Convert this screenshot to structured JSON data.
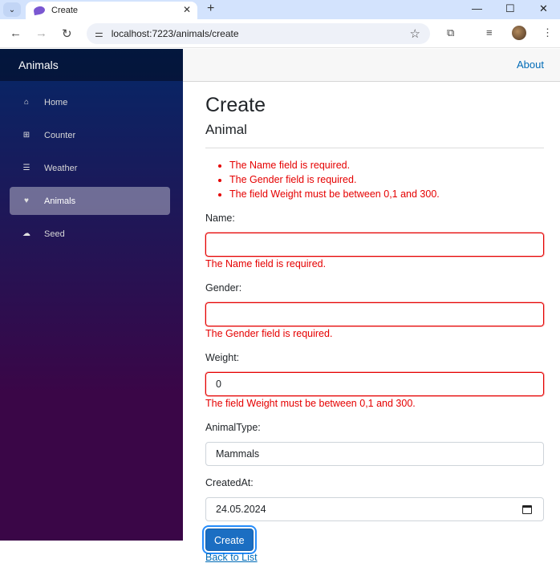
{
  "browser": {
    "tab_title": "Create",
    "url": "localhost:7223/animals/create",
    "icons": {
      "tab_list": "chevron-down-icon",
      "tab_close": "close-icon",
      "new_tab": "plus-icon",
      "minimize": "minimize-icon",
      "maximize": "maximize-icon",
      "close_window": "close-icon",
      "back": "arrow-left-icon",
      "forward": "arrow-right-icon",
      "reload": "reload-icon",
      "site_info": "tune-icon",
      "bookmark": "star-icon",
      "extensions": "puzzle-icon",
      "media": "media-queue-icon",
      "menu": "kebab-menu-icon"
    },
    "glyphs": {
      "tab_list": "⌄",
      "tab_close": "✕",
      "new_tab": "+",
      "minimize": "—",
      "maximize": "☐",
      "close_window": "✕",
      "back": "←",
      "forward": "→",
      "reload": "↻",
      "site_info": "⚌",
      "bookmark": "☆",
      "extensions": "⧉",
      "media": "≡",
      "menu": "⋮"
    }
  },
  "sidebar": {
    "brand": "Animals",
    "items": [
      {
        "label": "Home",
        "icon": "home-icon",
        "glyph": "⌂",
        "active": false
      },
      {
        "label": "Counter",
        "icon": "plus-square-icon",
        "glyph": "⊞",
        "active": false
      },
      {
        "label": "Weather",
        "icon": "list-icon",
        "glyph": "☰",
        "active": false
      },
      {
        "label": "Animals",
        "icon": "animal-icon",
        "glyph": "♥",
        "active": true
      },
      {
        "label": "Seed",
        "icon": "cloud-upload-icon",
        "glyph": "☁",
        "active": false
      }
    ]
  },
  "topbar": {
    "about_label": "About"
  },
  "page": {
    "title": "Create",
    "subtitle": "Animal",
    "validation_summary": [
      "The Name field is required.",
      "The Gender field is required.",
      "The field Weight must be between 0,1 and 300."
    ],
    "fields": {
      "name": {
        "label": "Name:",
        "value": "",
        "error": "The Name field is required."
      },
      "gender": {
        "label": "Gender:",
        "value": "",
        "error": "The Gender field is required."
      },
      "weight": {
        "label": "Weight:",
        "value": "0",
        "error": "The field Weight must be between 0,1 and 300."
      },
      "animal_type": {
        "label": "AnimalType:",
        "value": "Mammals"
      },
      "created_at": {
        "label": "CreatedAt:",
        "value": "24.05.2024",
        "icon": "calendar-icon"
      }
    },
    "submit_label": "Create",
    "back_link": "Back to List"
  },
  "colors": {
    "accent": "#1b6ec2",
    "error": "#e50000",
    "link": "#006bb7"
  }
}
